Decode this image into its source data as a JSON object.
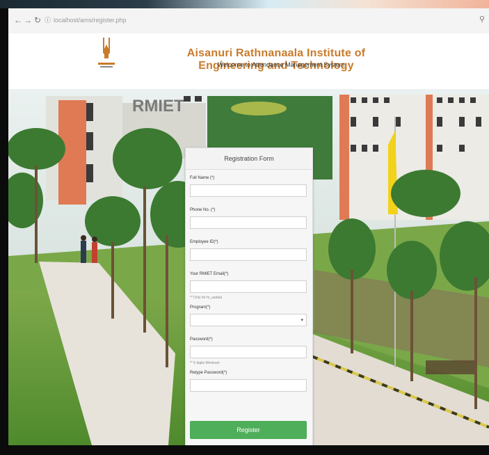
{
  "browser": {
    "url": "localhost/ams/register.php",
    "back_icon": "back-arrow-icon",
    "forward_icon": "forward-arrow-icon",
    "reload_icon": "reload-icon",
    "info_icon": "page-info-icon",
    "search_icon": "search-icon"
  },
  "header": {
    "institute_name": "Aisanuri Rathnanaala Institute of Engineering and Technology",
    "welcome_text": "Welcome to Attendance Management System",
    "logo_icon": "institute-logo"
  },
  "form": {
    "title": "Registration Form",
    "fields": [
      {
        "label": "Full Name (*)",
        "value": ""
      },
      {
        "label": "Phone No. (*)",
        "value": ""
      },
      {
        "label": "Employee ID(*)",
        "value": ""
      },
      {
        "label": "Your RMIET Email(*)",
        "value": ""
      }
    ],
    "email_hint": "** Only for fe_usdata",
    "program_label": "Program(*)",
    "program_selected": "",
    "password_label": "Password(*)",
    "password_hint": "** 6 digits Minimum",
    "confirm_label": "Retype Password(*)",
    "register_label": "Register"
  },
  "colors": {
    "title": "#c97b2b",
    "register_button": "#4fae5a"
  }
}
